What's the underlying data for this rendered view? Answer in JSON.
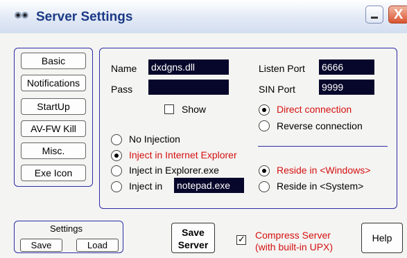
{
  "window": {
    "title": "Server Settings",
    "close_glyph": "X"
  },
  "nav": [
    "Basic",
    "Notifications",
    "StartUp",
    "AV-FW Kill",
    "Misc.",
    "Exe Icon"
  ],
  "form": {
    "name_label": "Name",
    "name_value": "dxdgns.dll",
    "pass_label": "Pass",
    "pass_value": "",
    "show_label": "Show",
    "show_checked": false,
    "listen_port_label": "Listen Port",
    "listen_port_value": "6666",
    "sin_port_label": "SIN Port",
    "sin_port_value": "9999",
    "connection": {
      "direct": "Direct connection",
      "reverse": "Reverse connection",
      "selected": "direct"
    },
    "injection": {
      "none": "No Injection",
      "ie": "Inject in Internet Explorer",
      "explorer": "Inject in Explorer.exe",
      "custom": "Inject in",
      "custom_value": "notepad.exe",
      "selected": "ie"
    },
    "reside": {
      "windows": "Reside in <Windows>",
      "system": "Reside in <System>",
      "selected": "windows"
    }
  },
  "settings": {
    "label": "Settings",
    "save": "Save",
    "load": "Load"
  },
  "save_server": {
    "line1": "Save",
    "line2": "Server"
  },
  "compress": {
    "line1": "Compress Server",
    "line2": "(with built-in UPX)",
    "checked": true
  },
  "help": "Help",
  "colors": {
    "selected_text": "#d41010",
    "field_bg": "#07072c",
    "group_border": "#2c2ca8",
    "title": "#1b3a86"
  }
}
